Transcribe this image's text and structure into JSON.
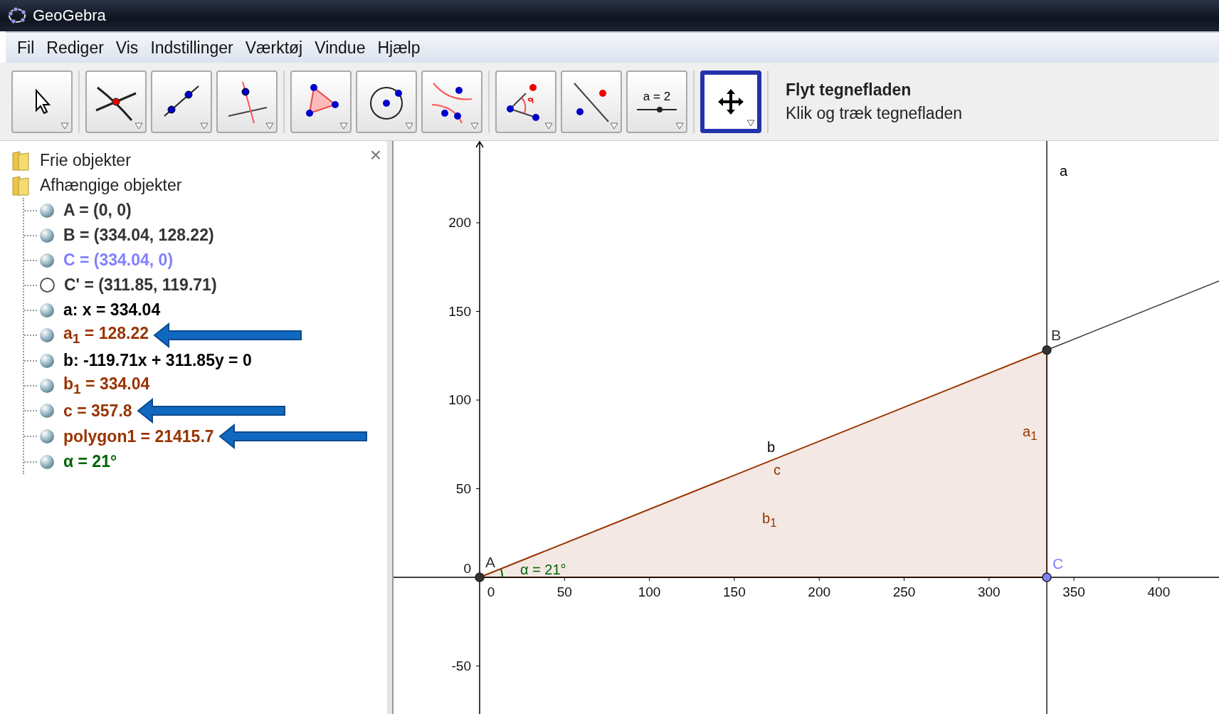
{
  "window": {
    "title": "GeoGebra"
  },
  "menu": [
    "Fil",
    "Rediger",
    "Vis",
    "Indstillinger",
    "Værktøj",
    "Vindue",
    "Hjælp"
  ],
  "toolbar": {
    "groups": [
      [
        {
          "kind": "pointer",
          "selected": false
        }
      ],
      [
        {
          "kind": "intersect",
          "selected": false
        },
        {
          "kind": "segment",
          "selected": false
        },
        {
          "kind": "perpendicular",
          "selected": false
        }
      ],
      [
        {
          "kind": "polygon",
          "selected": false
        },
        {
          "kind": "circle",
          "selected": false
        },
        {
          "kind": "conic",
          "selected": false
        }
      ],
      [
        {
          "kind": "angle",
          "selected": false
        },
        {
          "kind": "reflect",
          "selected": false
        },
        {
          "kind": "slider",
          "selected": false,
          "label": "a = 2"
        }
      ],
      [
        {
          "kind": "move",
          "selected": true
        }
      ]
    ],
    "help_title": "Flyt tegnefladen",
    "help_text": "Klik og træk tegnefladen"
  },
  "algebra": {
    "tree": [
      {
        "label": "Frie objekter"
      },
      {
        "label": "Afhængige objekter",
        "children": [
          {
            "text": "A = (0, 0)",
            "color": "#333333",
            "shown": true,
            "marked": false
          },
          {
            "text": "B = (334.04, 128.22)",
            "color": "#333333",
            "shown": true,
            "marked": false
          },
          {
            "text": "C = (334.04, 0)",
            "color": "#8080ff",
            "shown": true,
            "marked": false
          },
          {
            "text": "C' = (311.85, 119.71)",
            "color": "#333333",
            "shown": false,
            "marked": false
          },
          {
            "text": "a: x = 334.04",
            "color": "#000000",
            "shown": true,
            "marked": false
          },
          {
            "text": "a$_{1}$ = 128.22",
            "color": "#993300",
            "shown": true,
            "marked": true
          },
          {
            "text": "b: -119.71x + 311.85y = 0",
            "color": "#000000",
            "shown": true,
            "marked": false
          },
          {
            "text": "b$_{1}$ = 334.04",
            "color": "#993300",
            "shown": true,
            "marked": false
          },
          {
            "text": "c = 357.8",
            "color": "#993300",
            "shown": true,
            "marked": true
          },
          {
            "text": "polygon1 = 21415.7",
            "color": "#993300",
            "shown": true,
            "marked": true
          },
          {
            "text": "α = 21°",
            "color": "#006400",
            "shown": true,
            "marked": false
          }
        ]
      }
    ],
    "close": "×"
  },
  "graphics": {
    "x_ticks": [
      "0",
      "50",
      "100",
      "150",
      "200",
      "250",
      "300",
      "350",
      "400"
    ],
    "y_ticks": [
      "200",
      "150",
      "100",
      "50",
      "0",
      "-50"
    ],
    "points": [
      {
        "label": "A",
        "color": "#333333"
      },
      {
        "label": "B",
        "color": "#333333"
      },
      {
        "label": "C",
        "color": "#8080ff"
      }
    ],
    "labels": [
      {
        "text": "a",
        "color": "#000000"
      },
      {
        "text": "b",
        "color": "#000000"
      },
      {
        "text": "c",
        "color": "#993300"
      },
      {
        "text": "a$_{1}$",
        "color": "#993300"
      },
      {
        "text": "b$_{1}$",
        "color": "#993300"
      },
      {
        "text": "α = 21°",
        "color": "#006400"
      }
    ]
  }
}
